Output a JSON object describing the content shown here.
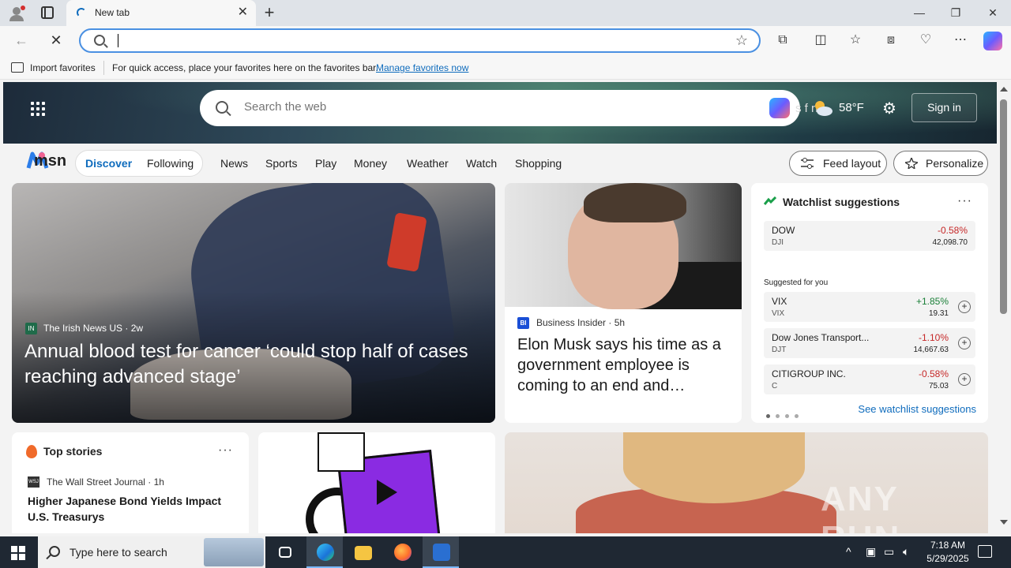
{
  "browser": {
    "tab_title": "New tab",
    "address_value": "",
    "favorites_bar": {
      "import_label": "Import favorites",
      "hint": "For quick access, place your favorites here on the favorites bar.",
      "manage_link": "Manage favorites now"
    }
  },
  "msn": {
    "search_placeholder": "Search the web",
    "weather_cut_text": "s f rf",
    "temperature": "58°F",
    "sign_in": "Sign in",
    "logo_text": "msn",
    "segments": [
      "Discover",
      "Following"
    ],
    "nav": [
      "News",
      "Sports",
      "Play",
      "Money",
      "Weather",
      "Watch",
      "Shopping"
    ],
    "feed_layout": "Feed layout",
    "personalize": "Personalize"
  },
  "hero_story": {
    "source": "The Irish News US",
    "age": "2w",
    "title": "Annual blood test for cancer ‘could stop half of cases reaching advanced stage’"
  },
  "second_story": {
    "source": "Business Insider",
    "age": "5h",
    "title": "Elon Musk says his time as a government employee is coming to an end and…"
  },
  "watchlist": {
    "title": "Watchlist suggestions",
    "pinned": [
      {
        "name": "DOW",
        "symbol": "DJI",
        "change": "-0.58%",
        "value": "42,098.70",
        "trend": "neg"
      }
    ],
    "suggested_label": "Suggested for you",
    "suggested": [
      {
        "name": "VIX",
        "symbol": "VIX",
        "change": "+1.85%",
        "value": "19.31",
        "trend": "pos"
      },
      {
        "name": "Dow Jones Transport...",
        "symbol": "DJT",
        "change": "-1.10%",
        "value": "14,667.63",
        "trend": "neg"
      },
      {
        "name": "CITIGROUP INC.",
        "symbol": "C",
        "change": "-0.58%",
        "value": "75.03",
        "trend": "neg"
      }
    ],
    "see_more": "See watchlist suggestions"
  },
  "top_stories": {
    "title": "Top stories",
    "source": "The Wall Street Journal",
    "age": "1h",
    "headline": "Higher Japanese Bond Yields Impact U.S. Treasurys"
  },
  "watermark": "ANY RUN",
  "taskbar": {
    "search_placeholder": "Type here to search",
    "time": "7:18 AM",
    "date": "5/29/2025"
  },
  "colors": {
    "accent": "#0f6cbd",
    "negative": "#c62828",
    "positive": "#1a7f37"
  }
}
